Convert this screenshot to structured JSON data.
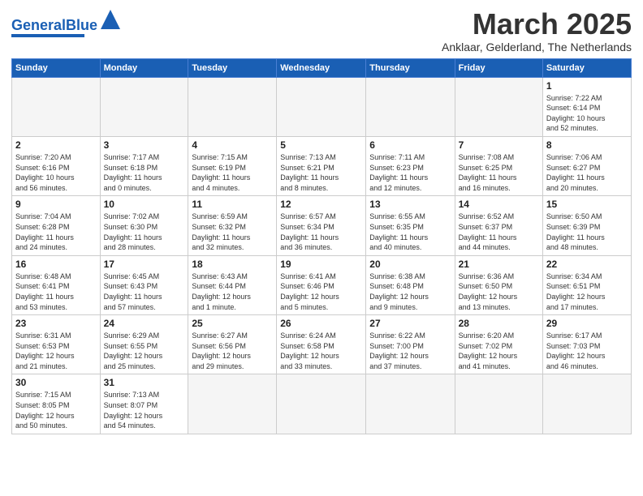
{
  "logo": {
    "text_general": "General",
    "text_blue": "Blue"
  },
  "header": {
    "month": "March 2025",
    "location": "Anklaar, Gelderland, The Netherlands"
  },
  "days_of_week": [
    "Sunday",
    "Monday",
    "Tuesday",
    "Wednesday",
    "Thursday",
    "Friday",
    "Saturday"
  ],
  "weeks": [
    [
      {
        "day": "",
        "info": ""
      },
      {
        "day": "",
        "info": ""
      },
      {
        "day": "",
        "info": ""
      },
      {
        "day": "",
        "info": ""
      },
      {
        "day": "",
        "info": ""
      },
      {
        "day": "",
        "info": ""
      },
      {
        "day": "1",
        "info": "Sunrise: 7:22 AM\nSunset: 6:14 PM\nDaylight: 10 hours\nand 52 minutes."
      }
    ],
    [
      {
        "day": "2",
        "info": "Sunrise: 7:20 AM\nSunset: 6:16 PM\nDaylight: 10 hours\nand 56 minutes."
      },
      {
        "day": "3",
        "info": "Sunrise: 7:17 AM\nSunset: 6:18 PM\nDaylight: 11 hours\nand 0 minutes."
      },
      {
        "day": "4",
        "info": "Sunrise: 7:15 AM\nSunset: 6:19 PM\nDaylight: 11 hours\nand 4 minutes."
      },
      {
        "day": "5",
        "info": "Sunrise: 7:13 AM\nSunset: 6:21 PM\nDaylight: 11 hours\nand 8 minutes."
      },
      {
        "day": "6",
        "info": "Sunrise: 7:11 AM\nSunset: 6:23 PM\nDaylight: 11 hours\nand 12 minutes."
      },
      {
        "day": "7",
        "info": "Sunrise: 7:08 AM\nSunset: 6:25 PM\nDaylight: 11 hours\nand 16 minutes."
      },
      {
        "day": "8",
        "info": "Sunrise: 7:06 AM\nSunset: 6:27 PM\nDaylight: 11 hours\nand 20 minutes."
      }
    ],
    [
      {
        "day": "9",
        "info": "Sunrise: 7:04 AM\nSunset: 6:28 PM\nDaylight: 11 hours\nand 24 minutes."
      },
      {
        "day": "10",
        "info": "Sunrise: 7:02 AM\nSunset: 6:30 PM\nDaylight: 11 hours\nand 28 minutes."
      },
      {
        "day": "11",
        "info": "Sunrise: 6:59 AM\nSunset: 6:32 PM\nDaylight: 11 hours\nand 32 minutes."
      },
      {
        "day": "12",
        "info": "Sunrise: 6:57 AM\nSunset: 6:34 PM\nDaylight: 11 hours\nand 36 minutes."
      },
      {
        "day": "13",
        "info": "Sunrise: 6:55 AM\nSunset: 6:35 PM\nDaylight: 11 hours\nand 40 minutes."
      },
      {
        "day": "14",
        "info": "Sunrise: 6:52 AM\nSunset: 6:37 PM\nDaylight: 11 hours\nand 44 minutes."
      },
      {
        "day": "15",
        "info": "Sunrise: 6:50 AM\nSunset: 6:39 PM\nDaylight: 11 hours\nand 48 minutes."
      }
    ],
    [
      {
        "day": "16",
        "info": "Sunrise: 6:48 AM\nSunset: 6:41 PM\nDaylight: 11 hours\nand 53 minutes."
      },
      {
        "day": "17",
        "info": "Sunrise: 6:45 AM\nSunset: 6:43 PM\nDaylight: 11 hours\nand 57 minutes."
      },
      {
        "day": "18",
        "info": "Sunrise: 6:43 AM\nSunset: 6:44 PM\nDaylight: 12 hours\nand 1 minute."
      },
      {
        "day": "19",
        "info": "Sunrise: 6:41 AM\nSunset: 6:46 PM\nDaylight: 12 hours\nand 5 minutes."
      },
      {
        "day": "20",
        "info": "Sunrise: 6:38 AM\nSunset: 6:48 PM\nDaylight: 12 hours\nand 9 minutes."
      },
      {
        "day": "21",
        "info": "Sunrise: 6:36 AM\nSunset: 6:50 PM\nDaylight: 12 hours\nand 13 minutes."
      },
      {
        "day": "22",
        "info": "Sunrise: 6:34 AM\nSunset: 6:51 PM\nDaylight: 12 hours\nand 17 minutes."
      }
    ],
    [
      {
        "day": "23",
        "info": "Sunrise: 6:31 AM\nSunset: 6:53 PM\nDaylight: 12 hours\nand 21 minutes."
      },
      {
        "day": "24",
        "info": "Sunrise: 6:29 AM\nSunset: 6:55 PM\nDaylight: 12 hours\nand 25 minutes."
      },
      {
        "day": "25",
        "info": "Sunrise: 6:27 AM\nSunset: 6:56 PM\nDaylight: 12 hours\nand 29 minutes."
      },
      {
        "day": "26",
        "info": "Sunrise: 6:24 AM\nSunset: 6:58 PM\nDaylight: 12 hours\nand 33 minutes."
      },
      {
        "day": "27",
        "info": "Sunrise: 6:22 AM\nSunset: 7:00 PM\nDaylight: 12 hours\nand 37 minutes."
      },
      {
        "day": "28",
        "info": "Sunrise: 6:20 AM\nSunset: 7:02 PM\nDaylight: 12 hours\nand 41 minutes."
      },
      {
        "day": "29",
        "info": "Sunrise: 6:17 AM\nSunset: 7:03 PM\nDaylight: 12 hours\nand 46 minutes."
      }
    ],
    [
      {
        "day": "30",
        "info": "Sunrise: 7:15 AM\nSunset: 8:05 PM\nDaylight: 12 hours\nand 50 minutes."
      },
      {
        "day": "31",
        "info": "Sunrise: 7:13 AM\nSunset: 8:07 PM\nDaylight: 12 hours\nand 54 minutes."
      },
      {
        "day": "",
        "info": ""
      },
      {
        "day": "",
        "info": ""
      },
      {
        "day": "",
        "info": ""
      },
      {
        "day": "",
        "info": ""
      },
      {
        "day": "",
        "info": ""
      }
    ]
  ]
}
